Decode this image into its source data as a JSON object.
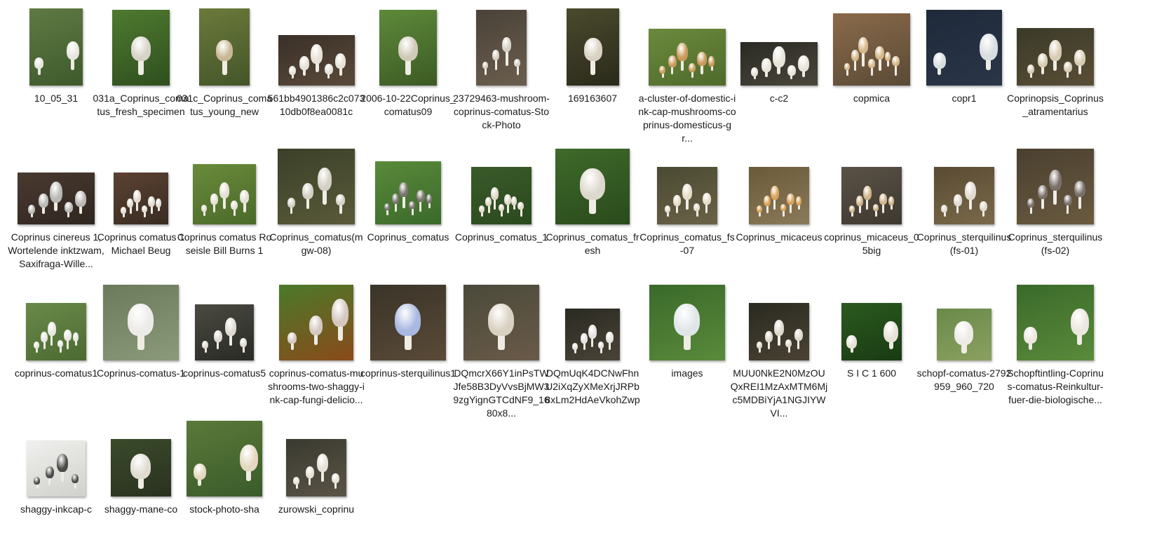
{
  "files": [
    {
      "name": "10_05_31"
    },
    {
      "name": "031a_Coprinus_comatus_fresh_specimen"
    },
    {
      "name": "031c_Coprinus_comatus_young_new"
    },
    {
      "name": "561bb4901386c2c07310db0f8ea0081c"
    },
    {
      "name": "2006-10-22Coprinus_comatus09"
    },
    {
      "name": "23729463-mushroom-coprinus-comatus-Stock-Photo"
    },
    {
      "name": "169163607"
    },
    {
      "name": "a-cluster-of-domestic-ink-cap-mushrooms-coprinus-domesticus-gr..."
    },
    {
      "name": "c-c2"
    },
    {
      "name": "copmica"
    },
    {
      "name": "copr1"
    },
    {
      "name": "Coprinopsis_Coprinus_atramentarius"
    },
    {
      "name": "Coprinus cinereus 1, Wortelende inktzwam, Saxifraga-Wille..."
    },
    {
      "name": "Coprinus comatus 1 Michael Beug"
    },
    {
      "name": "Coprinus comatus Roseisle Bill Burns 1"
    },
    {
      "name": "Coprinus_comatus(mgw-08)"
    },
    {
      "name": "Coprinus_comatus"
    },
    {
      "name": "Coprinus_comatus_1"
    },
    {
      "name": "Coprinus_comatus_fresh"
    },
    {
      "name": "Coprinus_comatus_fs-07"
    },
    {
      "name": "Coprinus_micaceus"
    },
    {
      "name": "coprinus_micaceus_05big"
    },
    {
      "name": "Coprinus_sterquilinus(fs-01)"
    },
    {
      "name": "Coprinus_sterquilinus(fs-02)"
    },
    {
      "name": "coprinus-comatus1"
    },
    {
      "name": "Coprinus-comatus-1"
    },
    {
      "name": "coprinus-comatus5"
    },
    {
      "name": "coprinus-comatus-mushrooms-two-shaggy-ink-cap-fungi-delicio..."
    },
    {
      "name": "coprinus-sterquilinus1"
    },
    {
      "name": "DQmcrX66Y1inPsTWJfe58B3DyVvsBjMW39zgYignGTCdNF9_1680x8..."
    },
    {
      "name": "DQmUqK4DCNwFhnU2iXqZyXMeXrjJRPb8xLm2HdAeVkohZwp"
    },
    {
      "name": "images"
    },
    {
      "name": "MUU0NkE2N0MzOUQxREI1MzAxMTM6Mjc5MDBiYjA1NGJIYWVI..."
    },
    {
      "name": "S I C 1 600"
    },
    {
      "name": "schopf-comatus-2792959_960_720"
    },
    {
      "name": "Schopftintling-Coprinus-comatus-Reinkultur-fuer-die-biologische..."
    },
    {
      "name": "shaggy-inkcap-c"
    },
    {
      "name": "shaggy-mane-co"
    },
    {
      "name": "stock-photo-sha"
    },
    {
      "name": "zurowski_coprinu"
    }
  ]
}
